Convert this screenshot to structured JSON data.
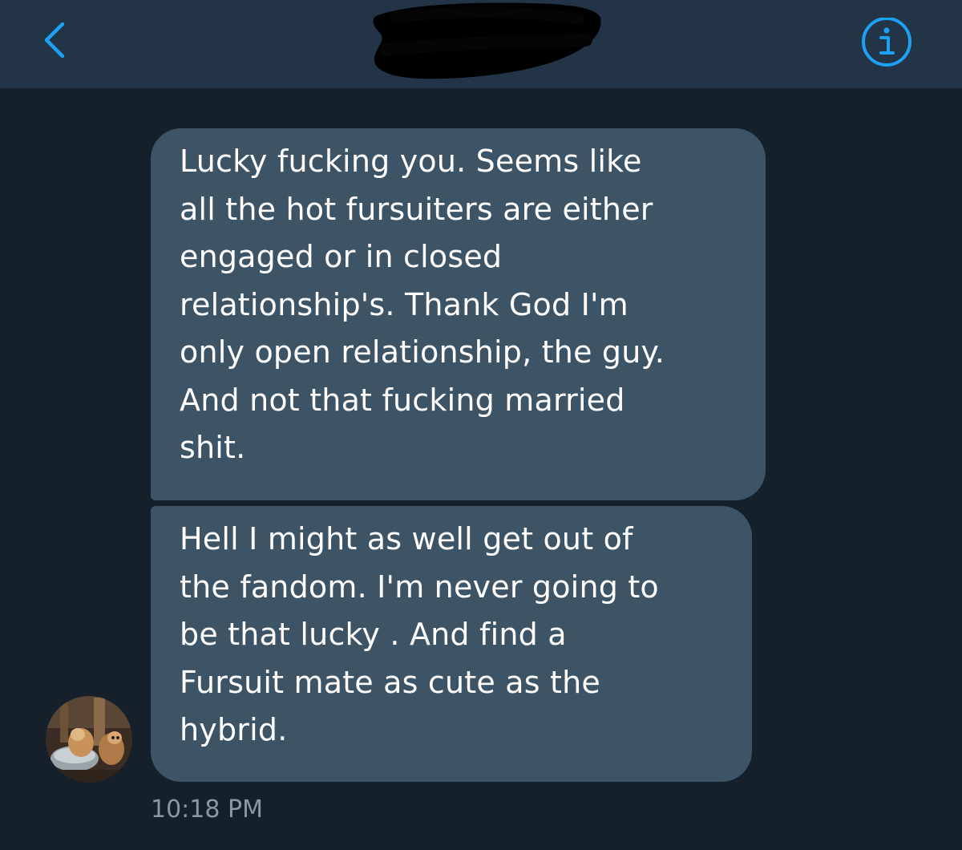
{
  "header": {
    "back_icon": "chevron-left-icon",
    "conversation_title": "",
    "info_icon": "info-circle-icon",
    "accent_color": "#1da1f2",
    "background_color": "#243447"
  },
  "thread": {
    "background_color": "#15202b",
    "bubble_color": "#3d5466",
    "messages": [
      {
        "text": "Lucky fucking you. Seems like\nall the hot fursuiters are either\nengaged or in closed\nrelationship's. Thank God I'm\nonly open relationship, the guy.\nAnd not that fucking married\nshit."
      },
      {
        "text": "Hell I might as well get out of\nthe fandom. I'm never going to\nbe that lucky . And find a\nFursuit mate as cute as the\nhybrid."
      }
    ],
    "timestamp": "10:18 PM"
  }
}
